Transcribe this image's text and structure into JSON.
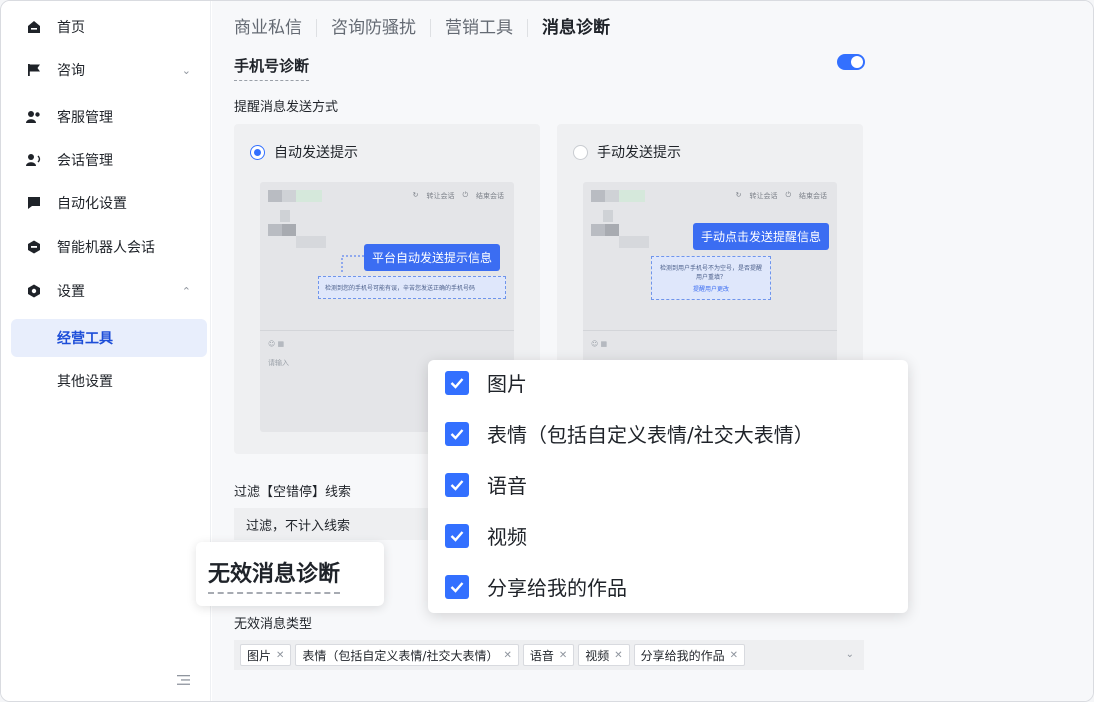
{
  "sidebar": {
    "items": [
      {
        "label": "首页",
        "icon": "home-icon"
      },
      {
        "label": "咨询",
        "icon": "flag-icon"
      },
      {
        "label": "客服管理",
        "icon": "users-icon"
      },
      {
        "label": "会话管理",
        "icon": "user-chat-icon"
      },
      {
        "label": "自动化设置",
        "icon": "message-icon"
      },
      {
        "label": "智能机器人会话",
        "icon": "robot-icon"
      },
      {
        "label": "设置",
        "icon": "gear-icon"
      }
    ],
    "sub_items": [
      {
        "label": "经营工具",
        "active": true
      },
      {
        "label": "其他设置",
        "active": false
      }
    ]
  },
  "tabs": [
    "商业私信",
    "咨询防骚扰",
    "营销工具",
    "消息诊断"
  ],
  "active_tab": "消息诊断",
  "phone_diagnosis": {
    "title": "手机号诊断",
    "enabled": true,
    "method_label": "提醒消息发送方式",
    "auto_option": "自动发送提示",
    "manual_option": "手动发送提示",
    "auto_callout": "平台自动发送提示信息",
    "manual_callout": "手动点击发送提醒信息",
    "mock_transfer": "转让会话",
    "mock_end": "结束会话",
    "auto_note": "检测到您的手机号可能有误，辛苦您发送正确的手机号码",
    "manual_note_1": "检测到用户手机号不为空号，是否提醒用户重填？",
    "manual_note_2": "提醒用户更改",
    "mock_input": "请输入"
  },
  "filter": {
    "label": "过滤【空错停】线索",
    "value": "过滤，不计入线索"
  },
  "invalid": {
    "badge": "无效消息诊断",
    "type_label": "无效消息类型",
    "tags": [
      "图片",
      "表情（包括自定义表情/社交大表情）",
      "语音",
      "视频",
      "分享给我的作品"
    ]
  },
  "dropdown_options": [
    "图片",
    "表情（包括自定义表情/社交大表情）",
    "语音",
    "视频",
    "分享给我的作品"
  ],
  "colors": {
    "accent": "#3370ff",
    "active_bg": "#e8eefc"
  }
}
